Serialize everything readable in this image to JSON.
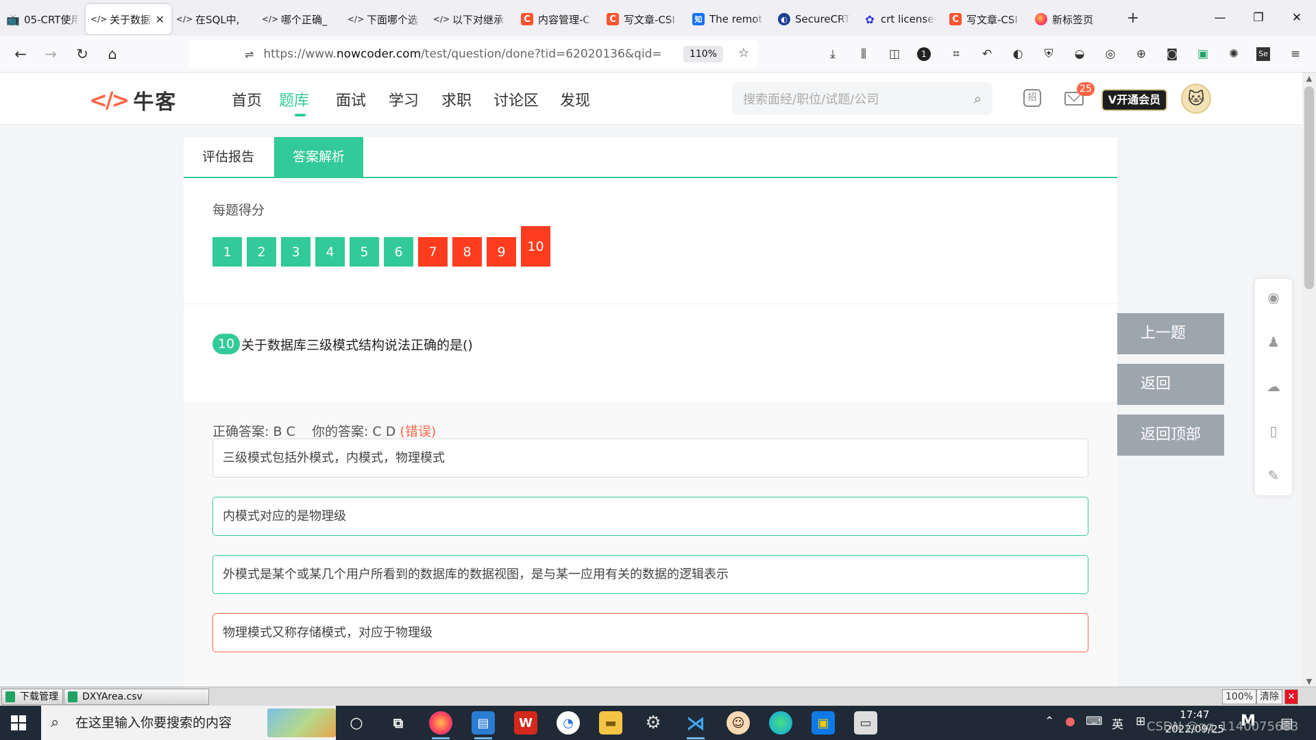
{
  "browser": {
    "tabs": [
      {
        "label": "05-CRT使用",
        "icon": "bilibili-icon",
        "active": false
      },
      {
        "label": "关于数据",
        "icon": "nowcoder-icon",
        "active": true
      },
      {
        "label": "在SQL中,",
        "icon": "nowcoder-icon",
        "active": false
      },
      {
        "label": "哪个正确_",
        "icon": "nowcoder-icon",
        "active": false
      },
      {
        "label": "下面哪个选",
        "icon": "nowcoder-icon",
        "active": false
      },
      {
        "label": "以下对继承",
        "icon": "nowcoder-icon",
        "active": false
      },
      {
        "label": "内容管理-C",
        "icon": "csdn-icon",
        "active": false
      },
      {
        "label": "写文章-CSI",
        "icon": "csdn-icon",
        "active": false
      },
      {
        "label": "The remot",
        "icon": "zhihu-icon",
        "active": false
      },
      {
        "label": "SecureCRT",
        "icon": "securecrt-icon",
        "active": false
      },
      {
        "label": "crt license",
        "icon": "baidu-icon",
        "active": false
      },
      {
        "label": "写文章-CSI",
        "icon": "csdn-icon",
        "active": false
      },
      {
        "label": "新标签页",
        "icon": "firefox-icon",
        "active": false
      }
    ],
    "url_prefix": "https://www.",
    "url_domain": "nowcoder.com",
    "url_rest": "/test/question/done?tid=62020136&qid=",
    "zoom": "110%"
  },
  "site": {
    "logo_text": "牛客",
    "nav": [
      "首页",
      "题库",
      "面试",
      "学习",
      "求职",
      "讨论区",
      "发现"
    ],
    "active_nav": "题库",
    "search_placeholder": "搜索面经/职位/试题/公司",
    "hire_icon_text": "招",
    "mail_count": "25",
    "vip_label": "V开通会员"
  },
  "page": {
    "tabs": [
      "评估报告",
      "答案解析"
    ],
    "active_tab": "答案解析",
    "score_label": "每题得分",
    "scores": [
      {
        "n": "1",
        "status": "correct"
      },
      {
        "n": "2",
        "status": "correct"
      },
      {
        "n": "3",
        "status": "correct"
      },
      {
        "n": "4",
        "status": "correct"
      },
      {
        "n": "5",
        "status": "correct"
      },
      {
        "n": "6",
        "status": "correct"
      },
      {
        "n": "7",
        "status": "wrong"
      },
      {
        "n": "8",
        "status": "wrong"
      },
      {
        "n": "9",
        "status": "wrong"
      },
      {
        "n": "10",
        "status": "wrong",
        "current": true
      }
    ],
    "question_number": "10",
    "question_text": "关于数据库三级模式结构说法正确的是()",
    "correct_label": "正确答案:",
    "correct_answer": "B C",
    "your_label": "你的答案:",
    "your_answer": "C D",
    "result": "(错误)",
    "options": [
      {
        "text": "三级模式包括外模式，内模式，物理模式",
        "state": "neutral"
      },
      {
        "text": "内模式对应的是物理级",
        "state": "correct"
      },
      {
        "text": "外模式是某个或某几个用户所看到的数据库的数据视图，是与某一应用有关的数据的逻辑表示",
        "state": "correct"
      },
      {
        "text": "物理模式又称存储模式，对应于物理级",
        "state": "incorrect"
      }
    ],
    "side_buttons": [
      "上一题",
      "返回",
      "返回顶部"
    ],
    "share_icons": [
      "weibo-icon",
      "qq-icon",
      "wechat-icon",
      "mobile-icon",
      "feedback-icon"
    ]
  },
  "downloads": {
    "items": [
      "下载管理",
      "DXYArea.csv"
    ],
    "zoom": "100%",
    "clear": "清除"
  },
  "taskbar": {
    "search_text": "在这里输入你要搜索的内容",
    "ime": "英",
    "time": "17:47",
    "date": "2022/09/25",
    "watermark": "CSDN @qq_1140075683"
  },
  "colors": {
    "accent": "#32ca99",
    "wrong": "#ff3d1e",
    "logo": "#ff6547"
  }
}
